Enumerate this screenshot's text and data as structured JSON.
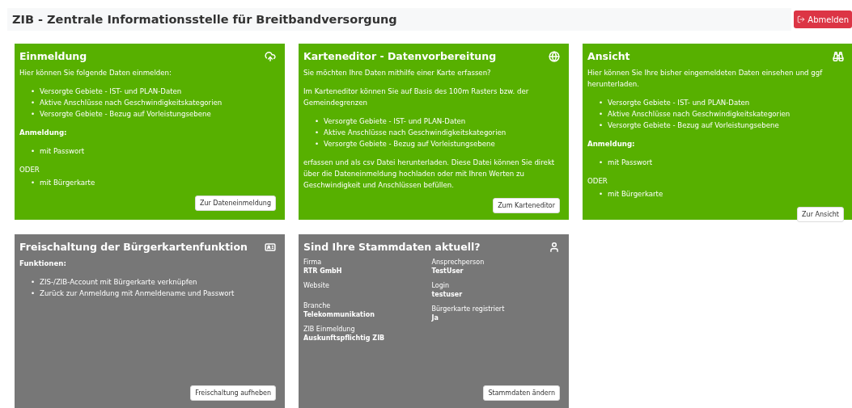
{
  "header": {
    "title": "ZIB - Zentrale Informationsstelle für Breitbandversorgung",
    "logout_button": "Abmelden"
  },
  "cards": [
    {
      "title": "Einmeldung",
      "color": "#57b000",
      "blocks": [
        {
          "kind": "text",
          "text": "Hier können Sie folgende Daten einmelden:"
        },
        {
          "kind": "list",
          "marker": "•",
          "items": [
            "Versorgte Gebiete - IST- und PLAN-Daten",
            "Aktive Anschlüsse nach Geschwindigkeitskategorien",
            "Versorgte Gebiete - Bezug auf Vorleistungsebene"
          ]
        },
        {
          "kind": "heading",
          "text": "Anmeldung:"
        },
        {
          "kind": "list",
          "marker": "•",
          "items": [
            "mit Passwort"
          ]
        },
        {
          "kind": "note",
          "text": "ODER"
        },
        {
          "kind": "list",
          "marker": "•",
          "items": [
            "mit Bürgerkarte"
          ]
        }
      ],
      "button": "Zur Dateneinmeldung"
    },
    {
      "title": "Karteneditor - Datenvorbereitung",
      "color": "#57b000",
      "blocks": [
        {
          "kind": "text",
          "text": "Sie möchten Ihre Daten mithilfe einer Karte erfassen?"
        },
        {
          "kind": "text",
          "text": "Im Karteneditor können Sie auf Basis des 100m Rasters bzw. der Gemeindegrenzen"
        },
        {
          "kind": "list",
          "marker": "•",
          "items": [
            "Versorgte Gebiete - IST- und PLAN-Daten",
            "Aktive Anschlüsse nach Geschwindigkeitskategorien",
            "Versorgte Gebiete - Bezug auf Vorleistungsebene"
          ]
        },
        {
          "kind": "text",
          "text": "erfassen und als csv Datei herunterladen. Diese Datei können Sie direkt über die Dateneinmeldung hochladen oder mit Ihren Werten zu Geschwindigkeit und Anschlüssen befüllen."
        }
      ],
      "button": "Zum Karteneditor"
    },
    {
      "title": "Ansicht",
      "color": "#57b000",
      "blocks": [
        {
          "kind": "text",
          "text": "Hier können Sie Ihre bisher eingemeldeten Daten einsehen und ggf herunterladen."
        },
        {
          "kind": "list",
          "marker": "•",
          "items": [
            "Versorgte Gebiete - IST- und PLAN-Daten",
            "Aktive Anschlüsse nach Geschwindigkeitskategorien",
            "Versorgte Gebiete - Bezug auf Vorleistungsebene"
          ]
        },
        {
          "kind": "heading",
          "text": "Anmeldung:"
        },
        {
          "kind": "list",
          "marker": "•",
          "items": [
            "mit Passwort"
          ]
        },
        {
          "kind": "note",
          "text": "ODER"
        },
        {
          "kind": "list",
          "marker": "•",
          "items": [
            "mit Bürgerkarte"
          ]
        }
      ],
      "button": "Zur Ansicht"
    },
    {
      "title": "Freischaltung der Bürgerkartenfunktion",
      "color": "#777777",
      "blocks": [
        {
          "kind": "heading",
          "text": "Funktionen:"
        },
        {
          "kind": "list",
          "marker": "•",
          "items": [
            "ZIS-/ZIB-Account mit Bürgerkarte verknüpfen",
            "Zurück zur Anmeldung mit Anmeldename und Passwort"
          ]
        }
      ],
      "button": "Freischaltung aufheben"
    },
    {
      "title": "Sind Ihre Stammdaten aktuell?",
      "color": "#777777",
      "blocks": [
        {
          "kind": "fields",
          "columns": [
            [
              {
                "label": "Firma",
                "value": "RTR GmbH"
              },
              {
                "label": "Website"
              },
              {
                "label": "Branche",
                "value": "Telekommunikation"
              },
              {
                "label": "ZIB Einmeldung",
                "value": "Auskunftspflichtig ZIB"
              }
            ],
            [
              {
                "label": "Ansprechperson",
                "value": "TestUser"
              },
              {
                "label": "Login",
                "value": "testuser"
              },
              {
                "label": "Bürgerkarte registriert",
                "value": "Ja"
              }
            ]
          ]
        }
      ],
      "button": "Stammdaten ändern"
    }
  ]
}
